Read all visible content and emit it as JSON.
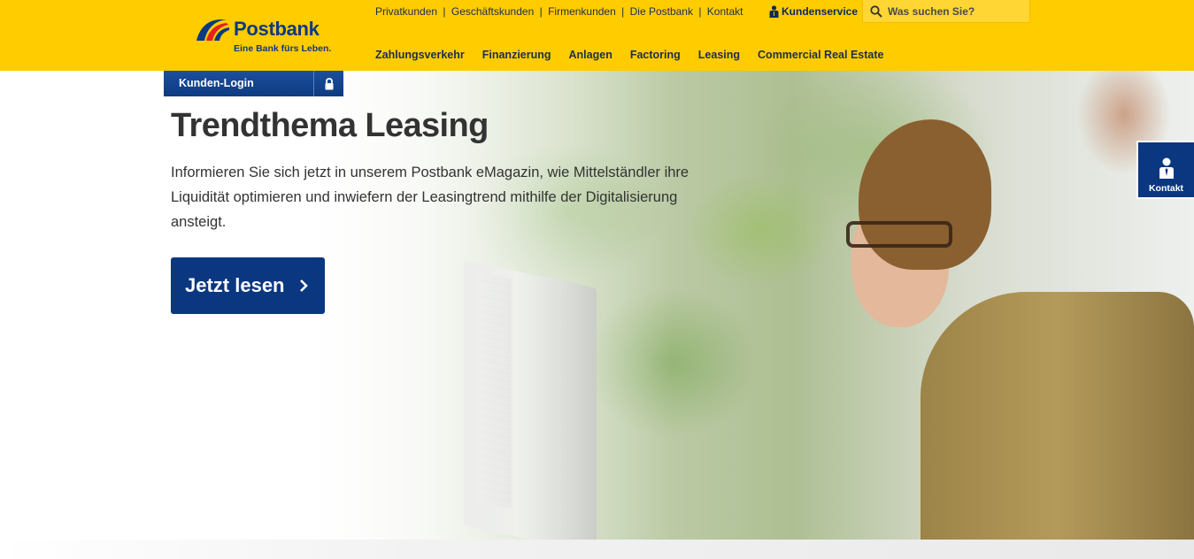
{
  "brand": {
    "name": "Postbank",
    "claim": "Eine Bank fürs Leben.",
    "colors": {
      "yellow": "#ffcc00",
      "blue": "#0a3780",
      "red": "#e2231a"
    }
  },
  "meta_nav": {
    "items": [
      "Privatkunden",
      "Geschäftskunden",
      "Firmenkunden",
      "Die Postbank",
      "Kontakt"
    ],
    "separator": "|"
  },
  "service": {
    "label": "Kundenservice",
    "icon": "person-icon"
  },
  "search": {
    "placeholder": "Was suchen Sie?",
    "value": "",
    "icon": "search-icon"
  },
  "main_nav": {
    "items": [
      "Zahlungsverkehr",
      "Finanzierung",
      "Anlagen",
      "Factoring",
      "Leasing",
      "Commercial Real Estate"
    ]
  },
  "login": {
    "label": "Kunden-Login",
    "icon": "lock-icon"
  },
  "hero": {
    "title": "Trendthema Leasing",
    "text": "Informieren Sie sich jetzt in unserem Postbank eMagazin, wie Mittelständler ihre Liquidität optimieren und inwiefern der Leasingtrend mithilfe der Digitalisierung ansteigt.",
    "cta_label": "Jetzt lesen",
    "cta_icon": "chevron-right-icon"
  },
  "kontakt_tab": {
    "label": "Kontakt",
    "icon": "person-icon"
  }
}
